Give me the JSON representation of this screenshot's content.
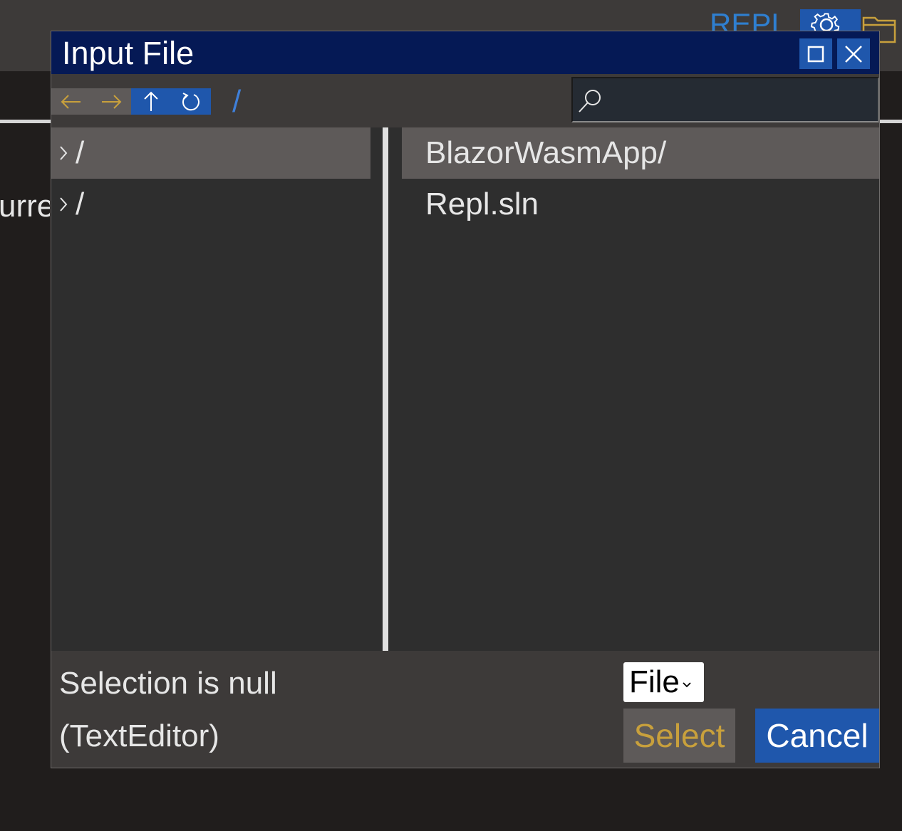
{
  "background": {
    "app_title": "REPL",
    "partial_label": "urre"
  },
  "dialog": {
    "title": "Input File",
    "path": "/",
    "search": {
      "value": "",
      "placeholder": ""
    },
    "tree": [
      {
        "label": "/",
        "selected": true
      },
      {
        "label": "/",
        "selected": false
      }
    ],
    "files": [
      {
        "label": "BlazorWasmApp/",
        "selected": true
      },
      {
        "label": "Repl.sln",
        "selected": false
      }
    ],
    "footer": {
      "status_line1": "Selection is null",
      "status_line2": "(TextEditor)",
      "type_select": "File",
      "select_label": "Select",
      "cancel_label": "Cancel"
    }
  },
  "colors": {
    "accent": "#1f57ac",
    "titlebar": "#051955",
    "select_text": "#c8a03c",
    "path_text": "#3f7fd8"
  }
}
